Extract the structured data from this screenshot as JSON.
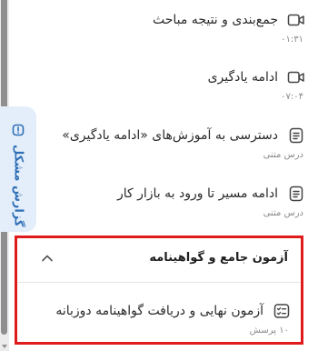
{
  "report_tab": {
    "label": "گزارش مشکل",
    "icon": "report-icon"
  },
  "lessons": [
    {
      "title": "جمع‌بندی و نتیجه مباحث",
      "meta": "۰۱:۳۱",
      "icon": "video-icon"
    },
    {
      "title": "ادامه یادگیری",
      "meta": "۰۷:۰۴",
      "icon": "video-icon"
    },
    {
      "title": "دسترسی به آموزش‌های «ادامه یادگیری»",
      "meta": "درس متنی",
      "icon": "document-icon"
    },
    {
      "title": "ادامه مسیر تا ورود به بازار کار",
      "meta": "درس متنی",
      "icon": "document-icon"
    }
  ],
  "section": {
    "title": "آزمون جامع و گواهینامه",
    "toggle_icon": "chevron-up-icon",
    "items": [
      {
        "title": "آزمون نهایی و دریافت گواهینامه دوزبانه",
        "meta": "۱۰ پرسش",
        "icon": "quiz-icon"
      }
    ]
  },
  "colors": {
    "highlight": "#e01b1b",
    "report_bg": "#e3eefa",
    "report_text": "#2f6fb5"
  }
}
